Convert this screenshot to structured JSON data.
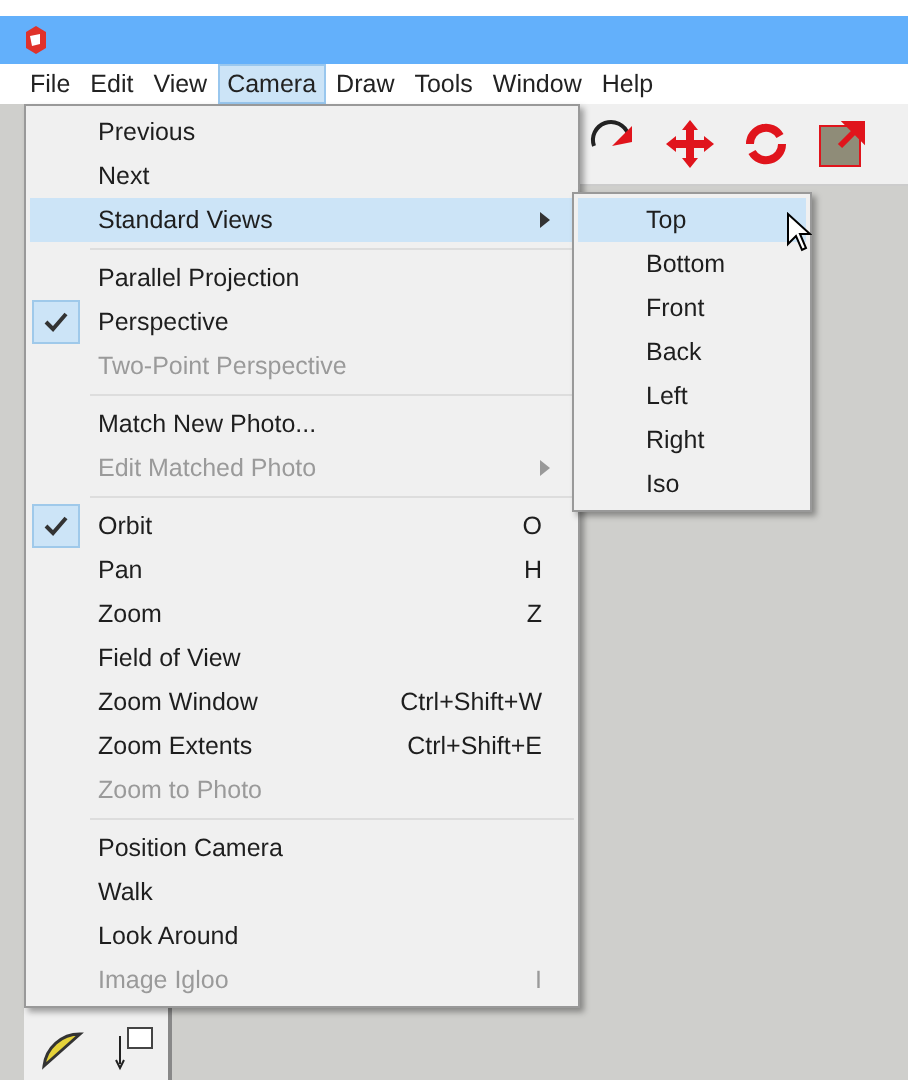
{
  "menubar": [
    {
      "label": "File",
      "selected": false
    },
    {
      "label": "Edit",
      "selected": false
    },
    {
      "label": "View",
      "selected": false
    },
    {
      "label": "Camera",
      "selected": true
    },
    {
      "label": "Draw",
      "selected": false
    },
    {
      "label": "Tools",
      "selected": false
    },
    {
      "label": "Window",
      "selected": false
    },
    {
      "label": "Help",
      "selected": false
    }
  ],
  "camera_menu": [
    [
      {
        "label": "Previous",
        "checked": false,
        "disabled": false,
        "selected": false,
        "kind": "item"
      },
      {
        "label": "Next",
        "checked": false,
        "disabled": false,
        "selected": false,
        "kind": "item"
      },
      {
        "label": "Standard Views",
        "checked": false,
        "disabled": false,
        "selected": true,
        "kind": "submenu"
      }
    ],
    [
      {
        "label": "Parallel Projection",
        "checked": false,
        "disabled": false,
        "selected": false,
        "kind": "item"
      },
      {
        "label": "Perspective",
        "checked": true,
        "disabled": false,
        "selected": false,
        "kind": "item"
      },
      {
        "label": "Two-Point Perspective",
        "checked": false,
        "disabled": true,
        "selected": false,
        "kind": "item"
      }
    ],
    [
      {
        "label": "Match New Photo...",
        "checked": false,
        "disabled": false,
        "selected": false,
        "kind": "item"
      },
      {
        "label": "Edit Matched Photo",
        "checked": false,
        "disabled": true,
        "selected": false,
        "kind": "submenu"
      }
    ],
    [
      {
        "label": "Orbit",
        "shortcut": "O",
        "checked": true,
        "disabled": false,
        "selected": false,
        "kind": "item"
      },
      {
        "label": "Pan",
        "shortcut": "H",
        "checked": false,
        "disabled": false,
        "selected": false,
        "kind": "item"
      },
      {
        "label": "Zoom",
        "shortcut": "Z",
        "checked": false,
        "disabled": false,
        "selected": false,
        "kind": "item"
      },
      {
        "label": "Field of View",
        "checked": false,
        "disabled": false,
        "selected": false,
        "kind": "item"
      },
      {
        "label": "Zoom Window",
        "shortcut": "Ctrl+Shift+W",
        "checked": false,
        "disabled": false,
        "selected": false,
        "kind": "item"
      },
      {
        "label": "Zoom Extents",
        "shortcut": "Ctrl+Shift+E",
        "checked": false,
        "disabled": false,
        "selected": false,
        "kind": "item"
      },
      {
        "label": "Zoom to Photo",
        "checked": false,
        "disabled": true,
        "selected": false,
        "kind": "item"
      }
    ],
    [
      {
        "label": "Position Camera",
        "checked": false,
        "disabled": false,
        "selected": false,
        "kind": "item"
      },
      {
        "label": "Walk",
        "checked": false,
        "disabled": false,
        "selected": false,
        "kind": "item"
      },
      {
        "label": "Look Around",
        "checked": false,
        "disabled": false,
        "selected": false,
        "kind": "item"
      },
      {
        "label": "Image Igloo",
        "shortcut": "I",
        "checked": false,
        "disabled": true,
        "selected": false,
        "kind": "item"
      }
    ]
  ],
  "standard_views_menu": [
    {
      "label": "Top",
      "selected": true
    },
    {
      "label": "Bottom",
      "selected": false
    },
    {
      "label": "Front",
      "selected": false
    },
    {
      "label": "Back",
      "selected": false
    },
    {
      "label": "Left",
      "selected": false
    },
    {
      "label": "Right",
      "selected": false
    },
    {
      "label": "Iso",
      "selected": false
    }
  ]
}
